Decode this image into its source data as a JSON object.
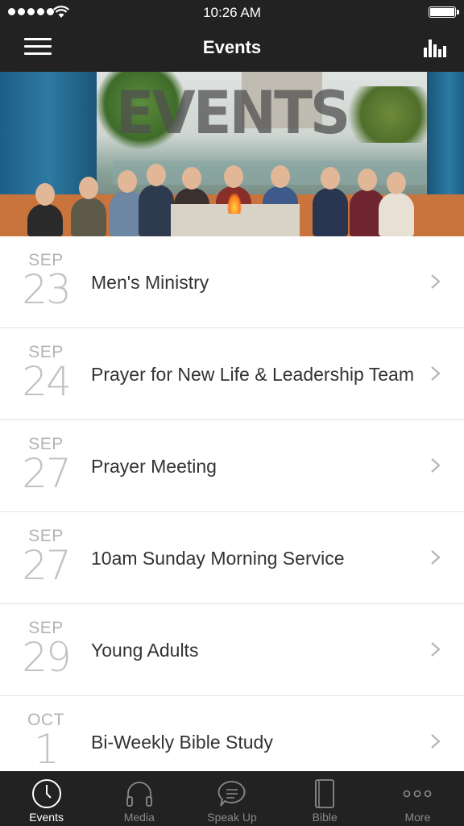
{
  "status_bar": {
    "time": "10:26 AM"
  },
  "nav": {
    "title": "Events",
    "menu_icon": "hamburger-icon",
    "chart_icon": "bar-chart-icon"
  },
  "hero": {
    "overlay_text": "EVENTS"
  },
  "events": [
    {
      "month": "SEP",
      "day": "23",
      "title": "Men's Ministry"
    },
    {
      "month": "SEP",
      "day": "24",
      "title": "Prayer for New Life & Leadership Team"
    },
    {
      "month": "SEP",
      "day": "27",
      "title": "Prayer Meeting"
    },
    {
      "month": "SEP",
      "day": "27",
      "title": "10am Sunday Morning Service"
    },
    {
      "month": "SEP",
      "day": "29",
      "title": "Young Adults"
    },
    {
      "month": "OCT",
      "day": "1",
      "title": "Bi-Weekly Bible Study"
    }
  ],
  "tabs": [
    {
      "label": "Events",
      "icon": "clock-icon",
      "active": true
    },
    {
      "label": "Media",
      "icon": "headphones-icon",
      "active": false
    },
    {
      "label": "Speak Up",
      "icon": "speech-bubble-icon",
      "active": false
    },
    {
      "label": "Bible",
      "icon": "book-icon",
      "active": false
    },
    {
      "label": "More",
      "icon": "more-dots-icon",
      "active": false
    }
  ],
  "colors": {
    "bar_background": "#222222",
    "list_background": "#ffffff",
    "date_gray": "#b3b3b3",
    "title_text": "#333333",
    "tab_inactive": "#8a8a8a"
  }
}
